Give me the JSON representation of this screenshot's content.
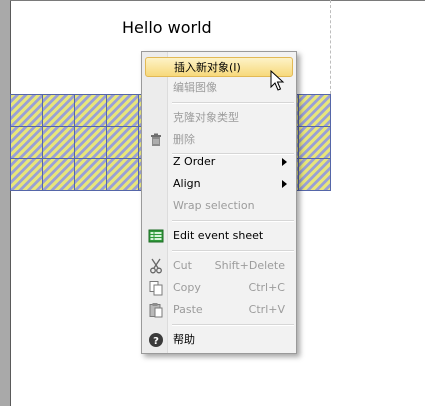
{
  "canvas": {
    "text_object": "Hello world"
  },
  "context_menu": {
    "items": [
      {
        "label": "插入新对象(I)",
        "state": "highlighted"
      },
      {
        "label": "编辑图像",
        "state": "disabled"
      },
      {
        "label": "克隆对象类型",
        "state": "disabled"
      },
      {
        "label": "删除",
        "state": "disabled",
        "icon": "trash-icon"
      },
      {
        "label": "Z Order",
        "state": "enabled",
        "submenu": true
      },
      {
        "label": "Align",
        "state": "enabled",
        "submenu": true
      },
      {
        "label": "Wrap selection",
        "state": "disabled"
      },
      {
        "label": "Edit event sheet",
        "state": "enabled",
        "icon": "event-sheet-icon"
      },
      {
        "label": "Cut",
        "shortcut": "Shift+Delete",
        "state": "disabled",
        "icon": "scissors-icon"
      },
      {
        "label": "Copy",
        "shortcut": "Ctrl+C",
        "state": "disabled",
        "icon": "copy-icon"
      },
      {
        "label": "Paste",
        "shortcut": "Ctrl+V",
        "state": "disabled",
        "icon": "paste-icon"
      },
      {
        "label": "帮助",
        "state": "enabled",
        "icon": "help-icon"
      }
    ]
  },
  "colors": {
    "highlight": "#f7d97b",
    "tile_stripe_a": "#e8e67a",
    "tile_stripe_b": "#9aa0d6",
    "workspace_bg": "#a9a9a9"
  }
}
